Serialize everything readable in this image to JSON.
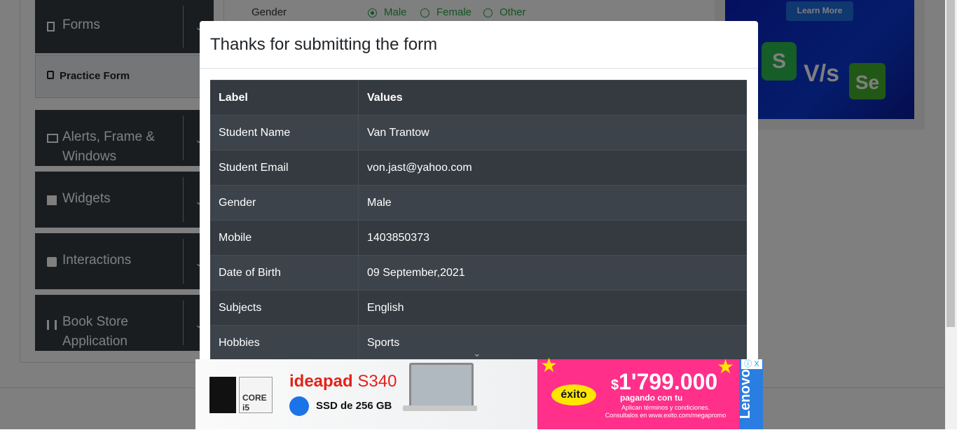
{
  "sidebar": {
    "groups": [
      {
        "label": "Forms",
        "icon": "document-icon"
      },
      {
        "label": "Alerts, Frame & Windows",
        "icon": "window-icon"
      },
      {
        "label": "Widgets",
        "icon": "widgets-icon"
      },
      {
        "label": "Interactions",
        "icon": "interactions-icon"
      },
      {
        "label": "Book Store Application",
        "icon": "books-icon"
      }
    ],
    "active_item": "Practice Form"
  },
  "form_background": {
    "gender_label": "Gender",
    "options": [
      "Male",
      "Female",
      "Other"
    ],
    "selected": "Male"
  },
  "top_ad": {
    "button": "Learn More",
    "vs_text": "V/s",
    "logo_s": "S",
    "logo_se": "Se"
  },
  "modal": {
    "title": "Thanks for submitting the form",
    "table": {
      "headers": [
        "Label",
        "Values"
      ],
      "rows": [
        [
          "Student Name",
          "Van Trantow"
        ],
        [
          "Student Email",
          "von.jast@yahoo.com"
        ],
        [
          "Gender",
          "Male"
        ],
        [
          "Mobile",
          "1403850373"
        ],
        [
          "Date of Birth",
          "09 September,2021"
        ],
        [
          "Subjects",
          "English"
        ],
        [
          "Hobbies",
          "Sports"
        ]
      ]
    }
  },
  "ad_banner": {
    "brand_model": "ideapad",
    "model_suffix": "S340",
    "storage": "SSD de 256 GB",
    "cpu_badge": "CORE i5",
    "store": "éxito",
    "price": "1'799.000",
    "price_prefix": "$",
    "payment_note": "pagando con tu",
    "terms_line1": "Aplican términos y condiciones.",
    "terms_line2": "Consultalos en www.exito.com/megapromo",
    "side_brand": "Lenovo",
    "close_label": "ⓘ X"
  },
  "colors": {
    "accent_green": "#28a745",
    "dark_table": "#343a40",
    "ad_pink": "#ff2f8a",
    "lenovo_blue": "#2a7de1"
  }
}
